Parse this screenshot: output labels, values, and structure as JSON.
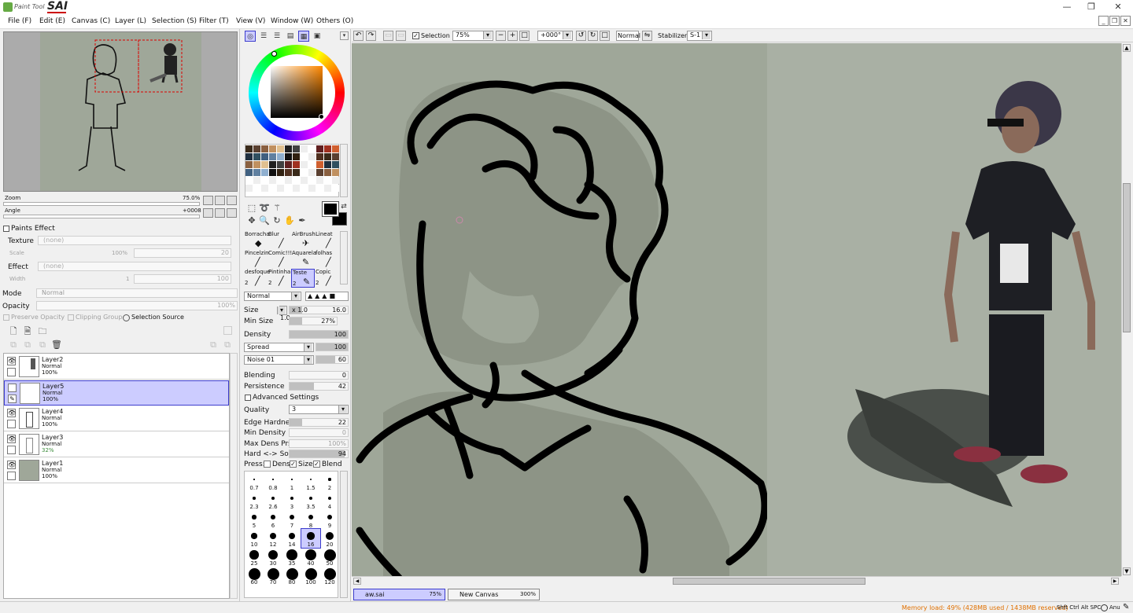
{
  "app": {
    "logo_small": "Paint Tool",
    "logo_big": "SAI"
  },
  "menu": [
    "File (F)",
    "Edit (E)",
    "Canvas (C)",
    "Layer (L)",
    "Selection (S)",
    "Filter (T)",
    "View (V)",
    "Window (W)",
    "Others (O)"
  ],
  "navigator": {
    "zoom_label": "Zoom",
    "zoom_value": "75.0%",
    "angle_label": "Angle",
    "angle_value": "+0008"
  },
  "paints_effect": {
    "title": "Paints Effect",
    "texture_label": "Texture",
    "texture_value": "(none)",
    "scale_label": "Scale",
    "scale_value": "100%",
    "scale_num": "20",
    "effect_label": "Effect",
    "effect_value": "(none)",
    "width_label": "Width",
    "width_value": "1",
    "width_num": "100"
  },
  "layer_props": {
    "mode_label": "Mode",
    "mode_value": "Normal",
    "opacity_label": "Opacity",
    "opacity_value": "100%",
    "preserve_opacity": "Preserve Opacity",
    "clipping_group": "Clipping Group",
    "selection_source": "Selection Source"
  },
  "layers": [
    {
      "name": "Layer2",
      "mode": "Normal",
      "opacity": "100%",
      "selected": false
    },
    {
      "name": "Layer5",
      "mode": "Normal",
      "opacity": "100%",
      "selected": true
    },
    {
      "name": "Layer4",
      "mode": "Normal",
      "opacity": "100%",
      "selected": false
    },
    {
      "name": "Layer3",
      "mode": "Normal",
      "opacity": "32%",
      "selected": false
    },
    {
      "name": "Layer1",
      "mode": "Normal",
      "opacity": "100%",
      "selected": false
    }
  ],
  "tools": [
    {
      "name": "Borracha",
      "size": ""
    },
    {
      "name": "Blur",
      "size": ""
    },
    {
      "name": "AirBrush",
      "size": ""
    },
    {
      "name": "Lineat",
      "size": ""
    },
    {
      "name": "Pincelzin",
      "size": ""
    },
    {
      "name": "Comic!!!",
      "size": ""
    },
    {
      "name": "Aquarela",
      "size": ""
    },
    {
      "name": "folhas",
      "size": ""
    },
    {
      "name": "desfoque",
      "size": "2"
    },
    {
      "name": "Pintinha",
      "size": "2"
    },
    {
      "name": "Teste",
      "size": "2"
    },
    {
      "name": "Copic",
      "size": "2"
    }
  ],
  "brush": {
    "mode_value": "Normal",
    "size_label": "Size",
    "size_mult": "x 1.0",
    "size_value": "16.0",
    "size_fraction": 0.22,
    "min_size_label": "Min Size",
    "min_size_value": "27%",
    "min_size_fraction": 0.27,
    "density_label": "Density",
    "density_value": "100",
    "spread_value": "Spread",
    "spread_num": "100",
    "noise_value": "Noise 01",
    "noise_num": "60",
    "noise_fraction": 0.6,
    "blending_label": "Blending",
    "blending_value": "0",
    "persistence_label": "Persistence",
    "persistence_value": "42",
    "persistence_fraction": 0.42,
    "advanced_label": "Advanced Settings",
    "quality_label": "Quality",
    "quality_value": "3",
    "edge_hardness_label": "Edge Hardness",
    "edge_hardness_value": "22",
    "edge_hardness_fraction": 0.22,
    "min_density_label": "Min Density",
    "min_density_value": "0",
    "max_dens_label": "Max Dens Prs.",
    "max_dens_value": "100%",
    "hard_soft_label": "Hard <-> Soft",
    "hard_soft_value": "94",
    "hard_soft_fraction": 0.94,
    "press_label": "Press:",
    "press_dens": "Dens",
    "press_size": "Size",
    "press_blend": "Blend"
  },
  "brush_sizes": [
    "0.7",
    "0.8",
    "1",
    "1.5",
    "2",
    "2.3",
    "2.6",
    "3",
    "3.5",
    "4",
    "5",
    "6",
    "7",
    "8",
    "9",
    "10",
    "12",
    "14",
    "16",
    "20",
    "25",
    "30",
    "35",
    "40",
    "50",
    "60",
    "70",
    "80",
    "100",
    "120"
  ],
  "toolbar": {
    "selection_label": "Selection",
    "zoom_value": "75%",
    "rotate_value": "+000°",
    "blend_value": "Normal",
    "stabilizer_label": "Stabilizer",
    "stabilizer_value": "S-1"
  },
  "tabs": [
    {
      "name": "aw.sai",
      "zoom": "75%"
    },
    {
      "name": "New Canvas",
      "zoom": "300%"
    }
  ],
  "status": {
    "memory": "Memory load: 49% (428MB used / 1438MB reserved)",
    "keys": "Shft Ctrl Alt SPC",
    "extra": "Anu"
  },
  "colors": {
    "canvas_bg": "#9fa799",
    "accent": "#3c3ccc",
    "selected_bg": "#ccccff",
    "memory_text": "#e07000"
  }
}
